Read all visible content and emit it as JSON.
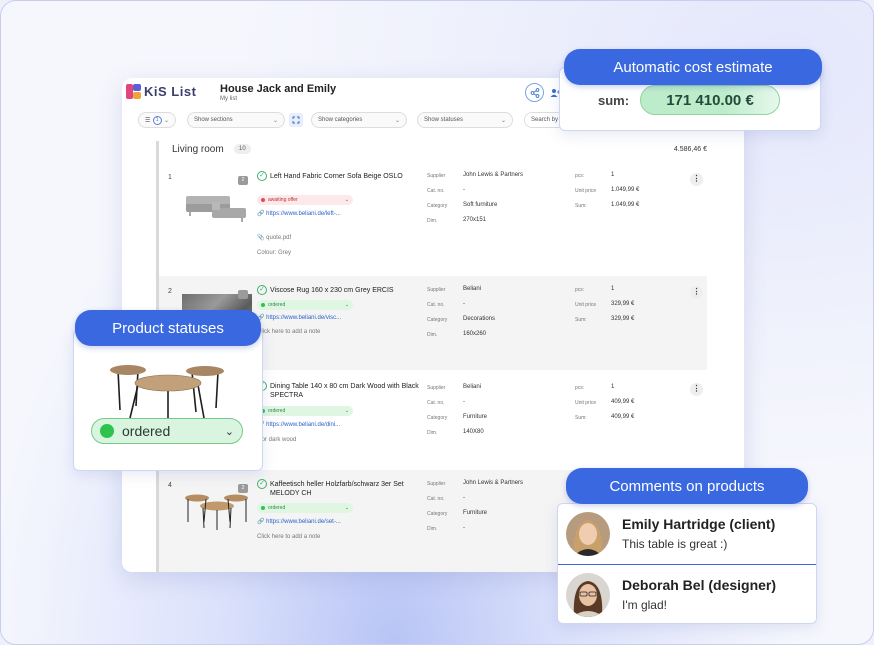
{
  "app": {
    "logo_text": "KiS List",
    "title": "House Jack and Emily",
    "subtitle": "My list",
    "toolbar": {
      "view_badge": "1",
      "sections_placeholder": "Show sections",
      "categories_placeholder": "Show categories",
      "statuses_placeholder": "Show statuses",
      "search_placeholder": "Search by na"
    },
    "section": {
      "title": "Living room",
      "count": "10",
      "total": "4.586,46 €"
    },
    "labels": {
      "supplier": "Supplier",
      "cat_no": "Cat. no.",
      "category": "Category",
      "dim": "Dim.",
      "pcs": "pcs:",
      "unit_price": "Unit price",
      "sum": "Sum:"
    },
    "products": [
      {
        "num": "1",
        "name": "Left Hand Fabric Corner Sofa Beige OSLO",
        "comments": "2",
        "status": "awaiting offer",
        "link": "https://www.beliani.de/left-...",
        "attachment": "quote.pdf",
        "note": "Colour: Grey",
        "supplier": "John Lewis & Partners",
        "cat_no": "-",
        "category": "Soft furniture",
        "dim": "270x151",
        "pcs": "1",
        "unit_price": "1.049,99 €",
        "sum": "1.049,99 €"
      },
      {
        "num": "2",
        "name": "Viscose Rug 160 x 230 cm Grey ERCIS",
        "comments": "",
        "status": "ordered",
        "link": "https://www.beliani.de/visc...",
        "note": "Click here to add a note",
        "supplier": "Beliani",
        "cat_no": "-",
        "category": "Decorations",
        "dim": "160x260",
        "pcs": "1",
        "unit_price": "329,99 €",
        "sum": "329,99 €"
      },
      {
        "num": "3",
        "name": "Dining Table 140 x 80 cm Dark Wood with Black SPECTRA",
        "comments": "",
        "status": "ordered",
        "link": "https://www.beliani.de/dini...",
        "note": "olor dark wood",
        "supplier": "Beliani",
        "cat_no": "-",
        "category": "Furniture",
        "dim": "140X80",
        "pcs": "1",
        "unit_price": "409,99 €",
        "sum": "409,99 €"
      },
      {
        "num": "4",
        "name": "Kaffeetisch heller Holzfarb/schwarz 3er Set MELODY CH",
        "comments": "2",
        "status": "ordered",
        "link": "https://www.beliani.de/set-...",
        "note": "Click here to add a note",
        "supplier": "John Lewis & Partners",
        "cat_no": "-",
        "category": "Furniture",
        "dim": "-"
      }
    ]
  },
  "callouts": {
    "cost": {
      "title": "Automatic cost estimate",
      "sum_label": "sum:",
      "sum_value": "171 410.00 €"
    },
    "statuses": {
      "title": "Product statuses",
      "selected": "ordered"
    },
    "comments": {
      "title": "Comments on products",
      "items": [
        {
          "name": "Emily Hartridge (client)",
          "text": "This table is great :)"
        },
        {
          "name": "Deborah Bel (designer)",
          "text": "I'm glad!"
        }
      ]
    }
  },
  "colors": {
    "accent": "#3a68e0",
    "ordered": "#2ec24e",
    "awaiting": "#e04a5a",
    "link": "#2a63c9"
  }
}
